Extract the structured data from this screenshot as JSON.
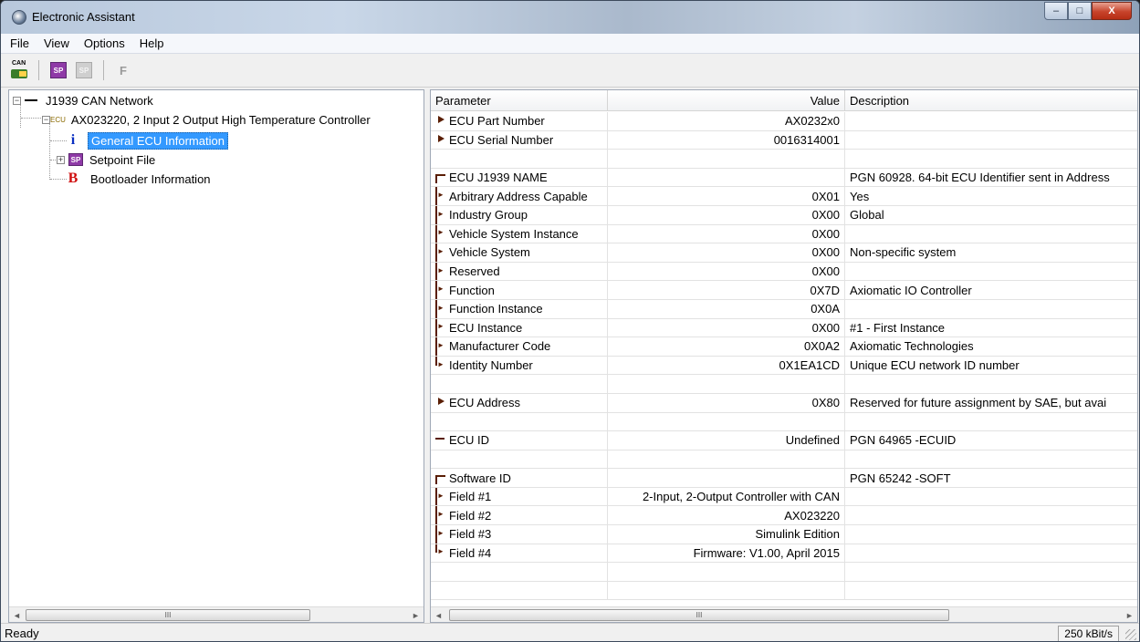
{
  "window": {
    "title": "Electronic Assistant",
    "caption_buttons": [
      "minimize",
      "maximize",
      "close"
    ],
    "close_glyph": "X",
    "min_glyph": "–",
    "max_glyph": "□"
  },
  "menu": [
    "File",
    "View",
    "Options",
    "Help"
  ],
  "toolbar": {
    "items": [
      "can-network-icon",
      "setpoint-file-icon",
      "setpoint-file-disabled-icon",
      "flash-icon"
    ],
    "can_label": "CAN",
    "sp_label": "SP",
    "f_label": "F"
  },
  "tree": {
    "network": "J1939 CAN Network",
    "ecu_tag": "ECU",
    "ecu": "AX023220, 2 Input 2 Output High Temperature Controller",
    "info_glyph": "i",
    "info": "General ECU Information",
    "sp_tag": "SP",
    "setpoint": "Setpoint File",
    "boot_glyph": "B",
    "bootloader": "Bootloader Information",
    "expand_minus": "−",
    "expand_plus": "+"
  },
  "grid": {
    "headers": {
      "parameter": "Parameter",
      "value": "Value",
      "description": "Description"
    },
    "rows": [
      {
        "mark": "tri",
        "parameter": "ECU Part Number",
        "value": "AX0232x0",
        "description": ""
      },
      {
        "mark": "tri",
        "parameter": "ECU Serial Number",
        "value": "0016314001",
        "description": ""
      },
      {
        "mark": "",
        "parameter": "",
        "value": "",
        "description": ""
      },
      {
        "mark": "top",
        "parameter": "ECU J1939 NAME",
        "value": "",
        "description": "PGN 60928. 64-bit ECU Identifier sent in Address"
      },
      {
        "mark": "arr",
        "parameter": "Arbitrary Address Capable",
        "value": "0X01",
        "description": "Yes"
      },
      {
        "mark": "arr",
        "parameter": "Industry Group",
        "value": "0X00",
        "description": "Global"
      },
      {
        "mark": "arr",
        "parameter": "Vehicle System Instance",
        "value": "0X00",
        "description": ""
      },
      {
        "mark": "arr",
        "parameter": "Vehicle System",
        "value": "0X00",
        "description": "Non-specific system"
      },
      {
        "mark": "arr",
        "parameter": "Reserved",
        "value": "0X00",
        "description": ""
      },
      {
        "mark": "arr",
        "parameter": "Function",
        "value": "0X7D",
        "description": "Axiomatic IO Controller"
      },
      {
        "mark": "arr",
        "parameter": "Function Instance",
        "value": "0X0A",
        "description": ""
      },
      {
        "mark": "arr",
        "parameter": "ECU Instance",
        "value": "0X00",
        "description": "#1 - First Instance"
      },
      {
        "mark": "arr",
        "parameter": "Manufacturer Code",
        "value": "0X0A2",
        "description": "Axiomatic Technologies"
      },
      {
        "mark": "last",
        "parameter": "Identity Number",
        "value": "0X1EA1CD",
        "description": "Unique ECU network ID number"
      },
      {
        "mark": "",
        "parameter": "",
        "value": "",
        "description": ""
      },
      {
        "mark": "tri",
        "parameter": "ECU Address",
        "value": "0X80",
        "description": "Reserved for future assignment by SAE, but avai"
      },
      {
        "mark": "",
        "parameter": "",
        "value": "",
        "description": ""
      },
      {
        "mark": "dash",
        "parameter": "ECU ID",
        "value": "Undefined",
        "description": "PGN 64965   -ECUID"
      },
      {
        "mark": "",
        "parameter": "",
        "value": "",
        "description": ""
      },
      {
        "mark": "top",
        "parameter": "Software ID",
        "value": "",
        "description": "PGN 65242   -SOFT"
      },
      {
        "mark": "arr",
        "parameter": "Field #1",
        "value": "2-Input, 2-Output Controller with CAN",
        "description": ""
      },
      {
        "mark": "arr",
        "parameter": "Field #2",
        "value": "AX023220",
        "description": ""
      },
      {
        "mark": "arr",
        "parameter": "Field #3",
        "value": "Simulink Edition",
        "description": ""
      },
      {
        "mark": "last",
        "parameter": "Field #4",
        "value": "Firmware: V1.00, April 2015",
        "description": ""
      },
      {
        "mark": "",
        "parameter": "",
        "value": "",
        "description": ""
      },
      {
        "mark": "",
        "parameter": "",
        "value": "",
        "description": ""
      }
    ]
  },
  "scroll": {
    "left_arrow": "◄",
    "right_arrow": "►",
    "thumb_grip": "III"
  },
  "status": {
    "text": "Ready",
    "rate": "250 kBit/s"
  }
}
